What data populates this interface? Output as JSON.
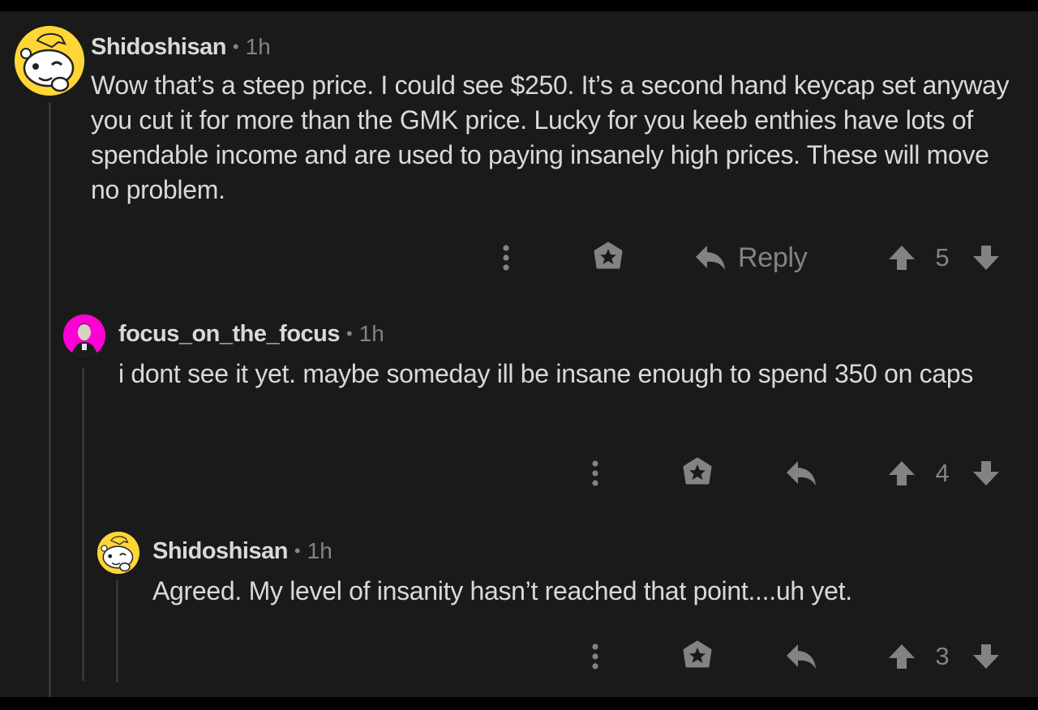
{
  "comments": [
    {
      "username": "Shidoshisan",
      "dot": "•",
      "time": "1h",
      "body": "Wow that’s a steep price. I could see $250. It’s a second hand keycap set anyway you cut it for more than the GMK price. Lucky for you keeb enthies have lots of spendable income and are used to paying insanely high prices. These will move no problem.",
      "reply_label": "Reply",
      "score": "5"
    },
    {
      "username": "focus_on_the_focus",
      "dot": "•",
      "time": "1h",
      "body": "i dont see it yet. maybe someday ill be insane enough to spend 350 on caps",
      "reply_label": "",
      "score": "4"
    },
    {
      "username": "Shidoshisan",
      "dot": "•",
      "time": "1h",
      "body": "Agreed. My level of insanity hasn’t reached that point....uh yet.",
      "reply_label": "",
      "score": "3"
    }
  ],
  "icons": {
    "more": "more-vertical-icon",
    "award": "award-icon",
    "reply": "reply-arrow-icon",
    "upvote": "upvote-arrow-icon",
    "downvote": "downvote-arrow-icon"
  },
  "colors": {
    "background": "#1a1a1b",
    "text": "#d7dadc",
    "muted": "#818384",
    "thread_line": "#343536",
    "snoo_yellow": "#ffd635",
    "avatar_magenta": "#ff00d4"
  }
}
